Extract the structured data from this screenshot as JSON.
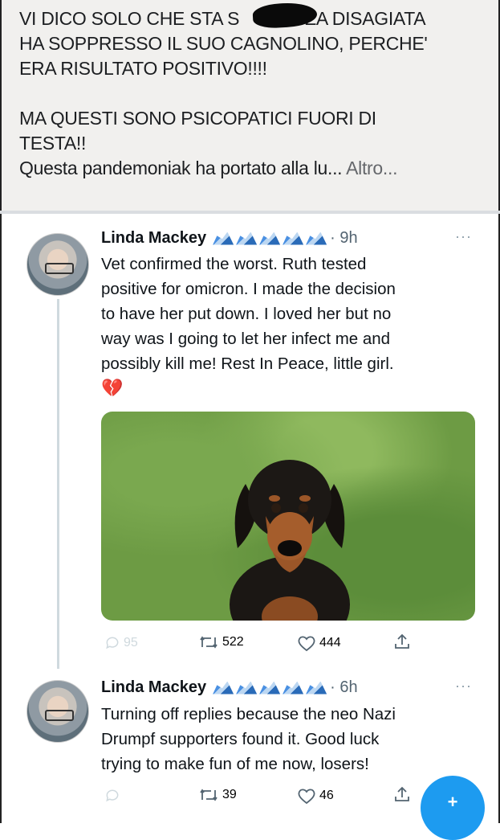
{
  "fb_post": {
    "lines": [
      "VI DICO SOLO CHE STA S",
      "ZA DISAGIATA",
      "HA SOPPRESSO IL SUO CAGNOLINO, PERCHE'",
      "ERA RISULTATO POSITIVO!!!!",
      "MA QUESTI SONO PSICOPATICI FUORI DI",
      "TESTA!!",
      "Questa pandemoniak ha portato alla lu...",
      "Altro..."
    ]
  },
  "tweets": [
    {
      "name": "Linda Mackey",
      "time": "· 9h",
      "menu": "···",
      "text_lines": [
        "Vet confirmed the worst. Ruth tested",
        "positive for omicron. I made the decision",
        "to have her put down. I loved her but no",
        "way was I going to let her infect me and",
        "possibly kill me! Rest In Peace, little girl."
      ],
      "emoji": "💔",
      "replies": "95",
      "retweets": "522",
      "likes": "444"
    },
    {
      "name": "Linda Mackey",
      "time": "· 6h",
      "menu": "···",
      "text_lines": [
        "Turning off replies because the neo Nazi",
        "Drumpf supporters found it. Good luck",
        "trying to make fun of me now, losers!"
      ],
      "retweets": "39",
      "likes": "46"
    }
  ],
  "fab_label": "+",
  "colors": {
    "accent": "#1d9bf0",
    "muted": "#536471",
    "fb_bg": "#f1f0ee"
  },
  "icons": [
    "reply-icon",
    "retweet-icon",
    "like-icon",
    "share-icon",
    "verified-badge-icon",
    "broken-heart-icon",
    "compose-icon"
  ]
}
